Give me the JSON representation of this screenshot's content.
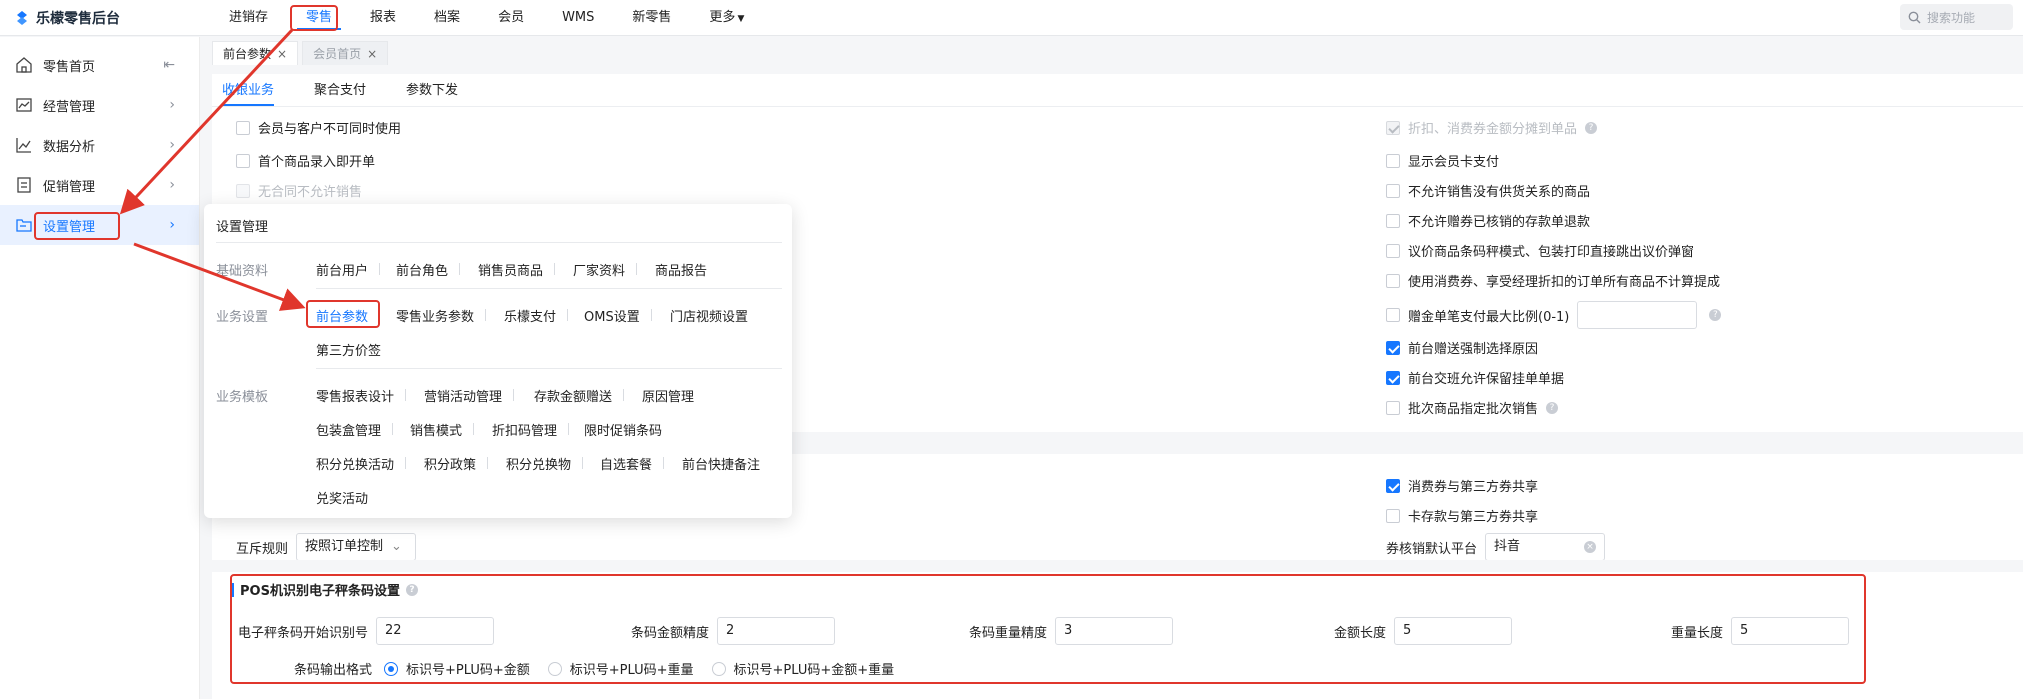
{
  "app": {
    "title": "乐檬零售后台"
  },
  "topnav": {
    "items": [
      "进销存",
      "零售",
      "报表",
      "档案",
      "会员",
      "WMS",
      "新零售",
      "更多"
    ],
    "search_placeholder": "搜索功能"
  },
  "sidebar": {
    "items": [
      {
        "label": "零售首页",
        "icon": "home-icon"
      },
      {
        "label": "经营管理",
        "icon": "chart-line-icon"
      },
      {
        "label": "数据分析",
        "icon": "trend-icon"
      },
      {
        "label": "促销管理",
        "icon": "tag-icon"
      },
      {
        "label": "设置管理",
        "icon": "folder-icon"
      }
    ]
  },
  "tabs": [
    {
      "label": "前台参数"
    },
    {
      "label": "会员首页"
    }
  ],
  "subtabs": [
    "收银业务",
    "聚合支付",
    "参数下发"
  ],
  "left_options": [
    "会员与客户不可同时使用",
    "首个商品录入即开单",
    "无合同不允许销售"
  ],
  "right_options": [
    {
      "label": "折扣、消费券金额分摊到单品",
      "state": "disabled-checked"
    },
    {
      "label": "显示会员卡支付",
      "state": "unchecked"
    },
    {
      "label": "不允许销售没有供货关系的商品",
      "state": "unchecked"
    },
    {
      "label": "不允许赠券已核销的存款单退款",
      "state": "unchecked"
    },
    {
      "label": "议价商品条码秤模式、包装打印直接跳出议价弹窗",
      "state": "unchecked"
    },
    {
      "label": "使用消费券、享受经理折扣的订单所有商品不计算提成",
      "state": "unchecked"
    },
    {
      "label": "赠金单笔支付最大比例(0-1)",
      "state": "unchecked"
    },
    {
      "label": "前台赠送强制选择原因",
      "state": "checked"
    },
    {
      "label": "前台交班允许保留挂单单据",
      "state": "checked"
    },
    {
      "label": "批次商品指定批次销售",
      "state": "unchecked"
    }
  ],
  "coupon_options": [
    {
      "label": "消费券与第三方券共享",
      "state": "checked"
    },
    {
      "label": "卡存款与第三方券共享",
      "state": "unchecked"
    }
  ],
  "mutex": {
    "label": "互斥规则",
    "value": "按照订单控制"
  },
  "coupon_platform": {
    "label": "券核销默认平台",
    "value": "抖音"
  },
  "popover": {
    "title": "设置管理",
    "groups": [
      {
        "label": "基础资料",
        "links": [
          "前台用户",
          "前台角色",
          "销售员商品",
          "厂家资料",
          "商品报告"
        ]
      },
      {
        "label": "业务设置",
        "links": [
          "前台参数",
          "零售业务参数",
          "乐檬支付",
          "OMS设置",
          "门店视频设置",
          "第三方价签"
        ]
      },
      {
        "label": "业务模板",
        "links": [
          "零售报表设计",
          "营销活动管理",
          "存款金额赠送",
          "原因管理",
          "包装盒管理",
          "销售模式",
          "折扣码管理",
          "限时促销条码",
          "积分兑换活动",
          "积分政策",
          "积分兑换物",
          "自选套餐",
          "前台快捷备注",
          "兑奖活动"
        ]
      }
    ]
  },
  "pos": {
    "title": "POS机识别电子秤条码设置",
    "fields": [
      {
        "label": "电子秤条码开始识别号",
        "value": "22"
      },
      {
        "label": "条码金额精度",
        "value": "2"
      },
      {
        "label": "条码重量精度",
        "value": "3"
      },
      {
        "label": "金额长度",
        "value": "5"
      },
      {
        "label": "重量长度",
        "value": "5"
      }
    ],
    "format_label": "条码输出格式",
    "formats": [
      {
        "label": "标识号+PLU码+金额",
        "checked": true
      },
      {
        "label": "标识号+PLU码+重量",
        "checked": false
      },
      {
        "label": "标识号+PLU码+金额+重量",
        "checked": false
      }
    ]
  },
  "colors": {
    "accent": "#1677ff",
    "callout": "#e0362c"
  }
}
